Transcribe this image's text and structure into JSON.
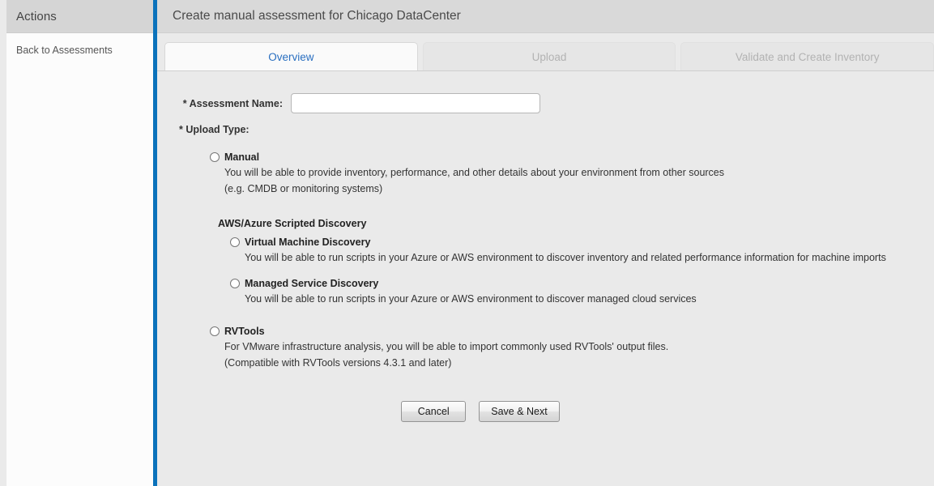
{
  "sidebar": {
    "header_title": "Actions",
    "links": [
      {
        "label": "Back to Assessments"
      }
    ]
  },
  "header": {
    "title": "Create manual assessment for Chicago DataCenter"
  },
  "tabs": [
    {
      "label": "Overview",
      "state": "active"
    },
    {
      "label": "Upload",
      "state": "disabled"
    },
    {
      "label": "Validate and Create Inventory",
      "state": "disabled"
    }
  ],
  "form": {
    "assessment_name": {
      "label": "* Assessment Name:",
      "value": "",
      "placeholder": ""
    },
    "upload_type": {
      "label": "* Upload Type:",
      "options": [
        {
          "id": "manual",
          "title": "Manual",
          "description_lines": [
            "You will be able to provide inventory, performance, and other details about your environment from other sources",
            "(e.g. CMDB or monitoring systems)"
          ]
        },
        {
          "id": "virtual-machine-discovery",
          "title": "Virtual Machine Discovery",
          "description_lines": [
            "You will be able to run scripts in your Azure or AWS environment to discover inventory and related performance information for machine imports"
          ]
        },
        {
          "id": "managed-service-discovery",
          "title": "Managed Service Discovery",
          "description_lines": [
            "You will be able to run scripts in your Azure or AWS environment to discover managed cloud services"
          ]
        },
        {
          "id": "rvtools",
          "title": "RVTools",
          "description_lines": [
            "For VMware infrastructure analysis, you will be able to import commonly used RVTools' output files.",
            "(Compatible with RVTools versions 4.3.1 and later)"
          ]
        }
      ],
      "group_heading": "AWS/Azure Scripted Discovery"
    }
  },
  "footer": {
    "cancel_label": "Cancel",
    "save_next_label": "Save & Next"
  },
  "colors": {
    "accent_blue": "#0b72bb",
    "tab_active_text": "#2a6fc0",
    "header_bg": "#d9d9d9",
    "panel_bg": "#eaeaea"
  }
}
